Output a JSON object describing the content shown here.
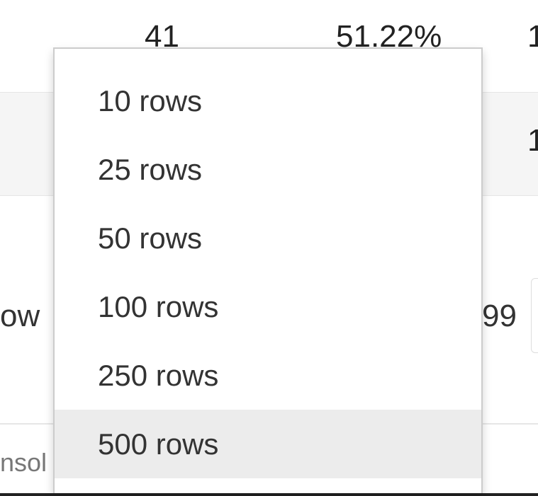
{
  "table": {
    "row1": {
      "count": "41",
      "percent": "51.22%",
      "edge": "1"
    },
    "row2": {
      "edge": "1"
    }
  },
  "pager": {
    "show_label_fragment": "ow",
    "value_fragment": "99"
  },
  "footer": {
    "text_fragment": "nsol"
  },
  "rows_menu": {
    "items": [
      {
        "label": "10 rows"
      },
      {
        "label": "25 rows"
      },
      {
        "label": "50 rows"
      },
      {
        "label": "100 rows"
      },
      {
        "label": "250 rows"
      },
      {
        "label": "500 rows"
      }
    ],
    "highlighted_label": "500 rows"
  },
  "colors": {
    "highlight": "#ececec",
    "row_stripe": "#f5f5f5",
    "menu_border": "#cccccc",
    "text": "#333333"
  }
}
